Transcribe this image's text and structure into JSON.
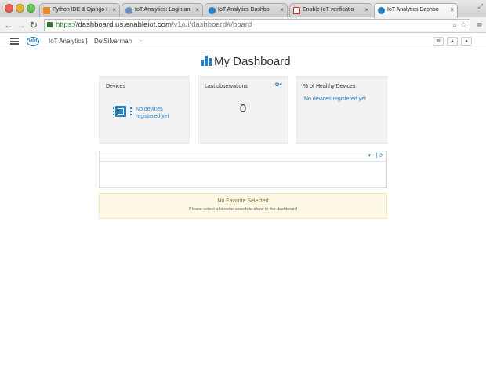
{
  "browser": {
    "tabs": [
      {
        "label": "Python IDE & Django I",
        "icon": "pycharm-icon",
        "color": "#e98b2a"
      },
      {
        "label": "IoT Analytics: Login an",
        "icon": "iot-icon",
        "color": "#6b8fb8"
      },
      {
        "label": "IoT Analytics Dashbo",
        "icon": "iot-globe-icon",
        "color": "#2a7fc1"
      },
      {
        "label": "Enable IoT verificatio",
        "icon": "gmail-icon",
        "color": "#d93025"
      },
      {
        "label": "IoT Analytics Dashbo",
        "icon": "iot-globe-icon",
        "color": "#2a7fc1",
        "active": true
      }
    ],
    "close_glyph": "×",
    "url_scheme": "https://",
    "url_host": "dashboard.us.enableiot.com",
    "url_path": "/v1/ui/dashboard#/board"
  },
  "appnav": {
    "logo_text": "intel",
    "product": "IoT Analytics |",
    "account": "DotSilverman",
    "dropdown": "-"
  },
  "dashboard": {
    "title": "My Dashboard",
    "accent": "#2a7fc1",
    "cards": {
      "devices": {
        "title": "Devices",
        "message_line1": "No devices",
        "message_line2": "registered yet"
      },
      "observations": {
        "title": "Last observations",
        "value": "0"
      },
      "healthy": {
        "title": "% of Healthy Devices",
        "message": "No devices registered yet"
      }
    },
    "favorite": {
      "tools": "▾ - | ⟳",
      "notice_title": "No Favorite Selected",
      "notice_text": "Please select a favorite search to show in the dashboard"
    }
  }
}
